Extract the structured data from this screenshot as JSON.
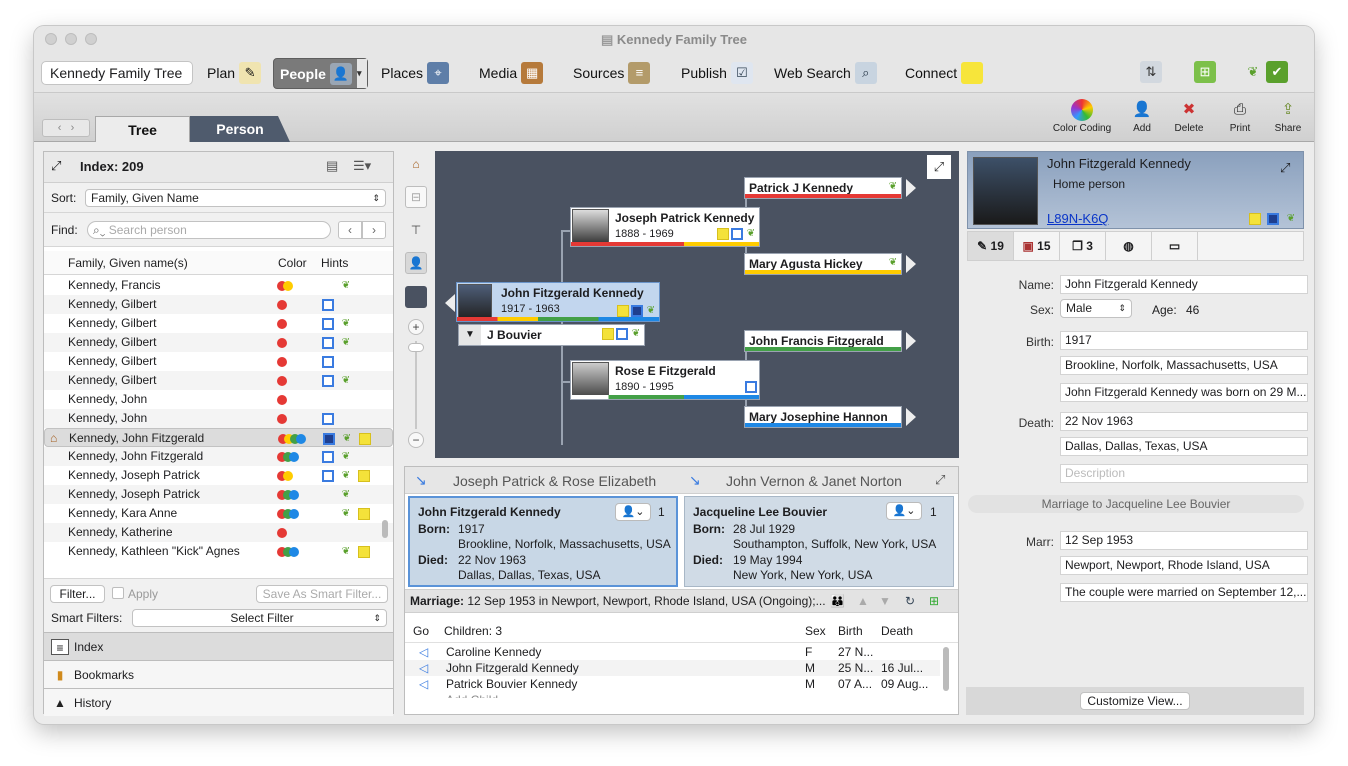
{
  "window": {
    "title": "Kennedy Family Tree"
  },
  "toolbar": {
    "family_selector": "Kennedy Family Tree",
    "plan": "Plan",
    "people": "People",
    "places": "Places",
    "media": "Media",
    "sources": "Sources",
    "publish": "Publish",
    "web_search": "Web Search",
    "connect": "Connect"
  },
  "tabs": {
    "tree": "Tree",
    "person": "Person"
  },
  "ribbon": {
    "color_coding": "Color Coding",
    "add": "Add",
    "delete": "Delete",
    "print": "Print",
    "share": "Share"
  },
  "index": {
    "title": "Index: 209",
    "sort_label": "Sort:",
    "sort_value": "Family, Given Name",
    "find_label": "Find:",
    "find_placeholder": "Search person",
    "col_name": "Family, Given name(s)",
    "col_color": "Color",
    "col_hints": "Hints",
    "rows": [
      {
        "name": "Kennedy, Francis",
        "color": "rY",
        "hints": [
          "leaf"
        ]
      },
      {
        "name": "Kennedy, Gilbert",
        "color": "r",
        "hints": [
          "sq"
        ]
      },
      {
        "name": "Kennedy, Gilbert",
        "color": "r",
        "hints": [
          "sq",
          "leaf"
        ]
      },
      {
        "name": "Kennedy, Gilbert",
        "color": "r",
        "hints": [
          "sq",
          "leaf"
        ]
      },
      {
        "name": "Kennedy, Gilbert",
        "color": "r",
        "hints": [
          "sq"
        ]
      },
      {
        "name": "Kennedy, Gilbert",
        "color": "r",
        "hints": [
          "sq",
          "leaf"
        ]
      },
      {
        "name": "Kennedy, John",
        "color": "r",
        "hints": []
      },
      {
        "name": "Kennedy, John",
        "color": "r",
        "hints": [
          "sq"
        ]
      },
      {
        "name": "Kennedy, John Fitzgerald",
        "color": "rygb",
        "hints": [
          "sqf",
          "leaf",
          "note"
        ],
        "home": true,
        "selected": true
      },
      {
        "name": "Kennedy, John Fitzgerald",
        "color": "rgb",
        "hints": [
          "sq",
          "leaf"
        ]
      },
      {
        "name": "Kennedy, Joseph Patrick",
        "color": "rY",
        "hints": [
          "sq",
          "leaf",
          "note"
        ]
      },
      {
        "name": "Kennedy, Joseph Patrick",
        "color": "rgb",
        "hints": [
          "leaf"
        ]
      },
      {
        "name": "Kennedy, Kara Anne",
        "color": "rgb",
        "hints": [
          "leaf",
          "note"
        ]
      },
      {
        "name": "Kennedy, Katherine",
        "color": "r",
        "hints": []
      },
      {
        "name": "Kennedy, Kathleen \"Kick\" Agnes",
        "color": "rgb",
        "hints": [
          "leaf",
          "note"
        ]
      }
    ],
    "filter_btn": "Filter...",
    "apply_label": "Apply",
    "save_smart": "Save As Smart Filter...",
    "smart_label": "Smart Filters:",
    "smart_value": "Select Filter",
    "side_tabs": [
      "Index",
      "Bookmarks",
      "History"
    ]
  },
  "tree": {
    "root": {
      "name": "John Fitzgerald Kennedy",
      "dates": "1917 - 1963"
    },
    "spouse": {
      "name": "J Bouvier"
    },
    "father": {
      "name": "Joseph Patrick Kennedy",
      "dates": "1888 - 1969"
    },
    "mother": {
      "name": "Rose E Fitzgerald",
      "dates": "1890 - 1995"
    },
    "pgf": {
      "name": "Patrick J Kennedy"
    },
    "pgm": {
      "name": "Mary Agusta Hickey"
    },
    "mgf": {
      "name": "John Francis Fitzgerald"
    },
    "mgm": {
      "name": "Mary Josephine Hannon"
    }
  },
  "family": {
    "parents_left": "Joseph Patrick & Rose Elizabeth",
    "parents_right": "John Vernon & Janet Norton",
    "left": {
      "name": "John Fitzgerald Kennedy",
      "count": "1",
      "born_label": "Born:",
      "born_date": "1917",
      "born_place": "Brookline, Norfolk, Massachusetts, USA",
      "died_label": "Died:",
      "died_date": "22 Nov 1963",
      "died_place": "Dallas, Dallas, Texas, USA"
    },
    "right": {
      "name": "Jacqueline Lee Bouvier",
      "count": "1",
      "born_label": "Born:",
      "born_date": "28 Jul 1929",
      "born_place": "Southampton, Suffolk, New York, USA",
      "died_label": "Died:",
      "died_date": "19 May 1994",
      "died_place": "New York, New York, USA"
    },
    "marriage_label": "Marriage:",
    "marriage_text": "12 Sep 1953 in Newport, Newport, Rhode Island, USA (Ongoing);...",
    "kids_cols": {
      "go": "Go",
      "children": "Children: 3",
      "sex": "Sex",
      "birth": "Birth",
      "death": "Death"
    },
    "children": [
      {
        "name": "Caroline Kennedy",
        "sex": "F",
        "birth": "27 N...",
        "death": ""
      },
      {
        "name": "John Fitzgerald Kennedy",
        "sex": "M",
        "birth": "25 N...",
        "death": "16 Jul..."
      },
      {
        "name": "Patrick Bouvier Kennedy",
        "sex": "M",
        "birth": "07 A...",
        "death": "09 Aug..."
      }
    ],
    "add_child": "Add Child"
  },
  "person": {
    "name": "John Fitzgerald Kennedy",
    "home": "Home person",
    "id": "L89N-K6Q",
    "tabs": {
      "facts": "19",
      "media": "15",
      "sources": "3"
    },
    "name_label": "Name:",
    "name_value": "John Fitzgerald Kennedy",
    "sex_label": "Sex:",
    "sex_value": "Male",
    "age_label": "Age:",
    "age_value": "46",
    "birth_label": "Birth:",
    "birth_date": "1917",
    "birth_place": "Brookline, Norfolk, Massachusetts, USA",
    "birth_desc": "John Fitzgerald Kennedy was born on 29 M...",
    "death_label": "Death:",
    "death_date": "22 Nov 1963",
    "death_place": "Dallas, Dallas, Texas, USA",
    "death_desc_placeholder": "Description",
    "marriage_header": "Marriage to Jacqueline Lee Bouvier",
    "marr_label": "Marr:",
    "marr_date": "12 Sep 1953",
    "marr_place": "Newport, Newport, Rhode Island, USA",
    "marr_desc": "The couple were married on September 12,...",
    "customize": "Customize View..."
  }
}
